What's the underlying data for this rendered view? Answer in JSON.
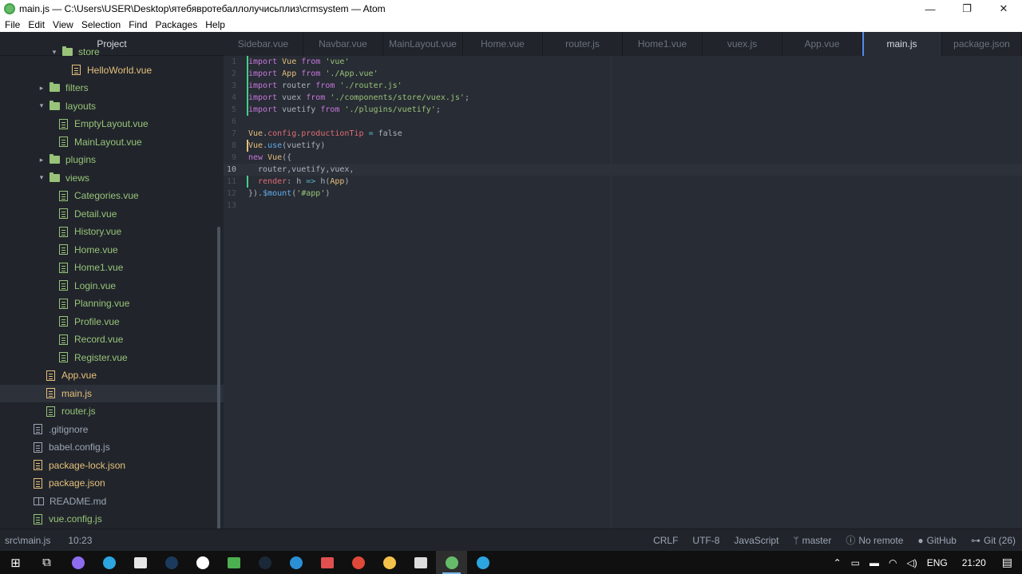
{
  "window": {
    "title": "main.js — C:\\Users\\USER\\Desktop\\ятебявротебаллолучисьплиз\\crmsystem — Atom",
    "minimize": "—",
    "maximize": "❐",
    "close": "✕"
  },
  "menu": [
    "File",
    "Edit",
    "View",
    "Selection",
    "Find",
    "Packages",
    "Help"
  ],
  "sidebar": {
    "title": "Project",
    "items": [
      {
        "label": "store",
        "type": "folder",
        "depth": 3,
        "arrow": "▾",
        "color": "green"
      },
      {
        "label": "HelloWorld.vue",
        "type": "file",
        "depth": 4,
        "color": "yellow"
      },
      {
        "label": "filters",
        "type": "folder",
        "depth": 2,
        "arrow": "▸",
        "color": "green"
      },
      {
        "label": "layouts",
        "type": "folder",
        "depth": 2,
        "arrow": "▾",
        "color": "green"
      },
      {
        "label": "EmptyLayout.vue",
        "type": "file",
        "depth": 3,
        "color": "green"
      },
      {
        "label": "MainLayout.vue",
        "type": "file",
        "depth": 3,
        "color": "green"
      },
      {
        "label": "plugins",
        "type": "folder",
        "depth": 2,
        "arrow": "▸",
        "color": "green"
      },
      {
        "label": "views",
        "type": "folder",
        "depth": 2,
        "arrow": "▾",
        "color": "green"
      },
      {
        "label": "Categories.vue",
        "type": "file",
        "depth": 3,
        "color": "green"
      },
      {
        "label": "Detail.vue",
        "type": "file",
        "depth": 3,
        "color": "green"
      },
      {
        "label": "History.vue",
        "type": "file",
        "depth": 3,
        "color": "green"
      },
      {
        "label": "Home.vue",
        "type": "file",
        "depth": 3,
        "color": "green"
      },
      {
        "label": "Home1.vue",
        "type": "file",
        "depth": 3,
        "color": "green"
      },
      {
        "label": "Login.vue",
        "type": "file",
        "depth": 3,
        "color": "green"
      },
      {
        "label": "Planning.vue",
        "type": "file",
        "depth": 3,
        "color": "green"
      },
      {
        "label": "Profile.vue",
        "type": "file",
        "depth": 3,
        "color": "green"
      },
      {
        "label": "Record.vue",
        "type": "file",
        "depth": 3,
        "color": "green"
      },
      {
        "label": "Register.vue",
        "type": "file",
        "depth": 3,
        "color": "green"
      },
      {
        "label": "App.vue",
        "type": "file",
        "depth": 2,
        "color": "yellow"
      },
      {
        "label": "main.js",
        "type": "file",
        "depth": 2,
        "color": "yellow",
        "selected": true
      },
      {
        "label": "router.js",
        "type": "file",
        "depth": 2,
        "color": "green"
      },
      {
        "label": ".gitignore",
        "type": "file",
        "depth": 1,
        "color": "grey"
      },
      {
        "label": "babel.config.js",
        "type": "file",
        "depth": 1,
        "color": "grey"
      },
      {
        "label": "package-lock.json",
        "type": "file",
        "depth": 1,
        "color": "yellow"
      },
      {
        "label": "package.json",
        "type": "file",
        "depth": 1,
        "color": "yellow"
      },
      {
        "label": "README.md",
        "type": "book",
        "depth": 1,
        "color": "grey"
      },
      {
        "label": "vue.config.js",
        "type": "file",
        "depth": 1,
        "color": "green"
      }
    ]
  },
  "tabs": [
    {
      "label": "Sidebar.vue"
    },
    {
      "label": "Navbar.vue"
    },
    {
      "label": "MainLayout.vue"
    },
    {
      "label": "Home.vue"
    },
    {
      "label": "router.js"
    },
    {
      "label": "Home1.vue"
    },
    {
      "label": "vuex.js"
    },
    {
      "label": "App.vue"
    },
    {
      "label": "main.js",
      "active": true
    },
    {
      "label": "package.json"
    }
  ],
  "code_lines": [
    "import Vue from 'vue'",
    "import App from './App.vue'",
    "import router from './router.js'",
    "import vuex from './components/store/vuex.js';",
    "import vuetify from './plugins/vuetify';",
    "",
    "Vue.config.productionTip = false",
    "Vue.use(vuetify)",
    "new Vue({",
    "  router,vuetify,vuex,",
    "  render: h => h(App)",
    "}).$mount('#app')",
    ""
  ],
  "cursor_line": 10,
  "status": {
    "path": "src\\main.js",
    "position": "10:23",
    "line_ending": "CRLF",
    "encoding": "UTF-8",
    "grammar": "JavaScript",
    "branch": "master",
    "remote": "No remote",
    "github": "GitHub",
    "git": "Git (26)"
  },
  "taskbar": {
    "language": "ENG",
    "time": "21:20",
    "apps": [
      {
        "name": "start",
        "glyph": "⊞"
      },
      {
        "name": "task-view",
        "glyph": "⧉"
      },
      {
        "name": "app-purple",
        "color": "#8e6cf0"
      },
      {
        "name": "telegram",
        "color": "#2ca5e0"
      },
      {
        "name": "app-windows",
        "color": "#e6e6e6"
      },
      {
        "name": "photoshop",
        "color": "#1b3a5c"
      },
      {
        "name": "yandex",
        "color": "#ffffff"
      },
      {
        "name": "app-green",
        "color": "#4caf50"
      },
      {
        "name": "steam",
        "color": "#1b2838"
      },
      {
        "name": "edge",
        "color": "#2b8fd6"
      },
      {
        "name": "app-red",
        "color": "#e05050"
      },
      {
        "name": "chrome",
        "color": "#e0483a"
      },
      {
        "name": "explorer",
        "color": "#f4c24a"
      },
      {
        "name": "terminal",
        "color": "#dddddd"
      },
      {
        "name": "atom",
        "color": "#66bb6a",
        "active": true
      },
      {
        "name": "telegram-2",
        "color": "#2ca5e0"
      }
    ]
  }
}
